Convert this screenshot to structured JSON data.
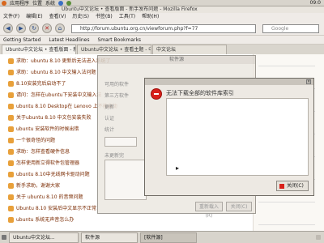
{
  "top_panel": {
    "items": [
      "应用程序",
      "位置",
      "系统"
    ],
    "clock": "09:0"
  },
  "window_title": "Ubuntu中文论坛 • 查看版面 - 新手发布问题 - Mozilla Firefox",
  "menu": [
    "文件(F)",
    "编辑(E)",
    "查看(V)",
    "历史(S)",
    "书签(B)",
    "工具(T)",
    "帮助(H)"
  ],
  "url": "http://forum.ubuntu.org.cn/viewforum.php?f=77",
  "search_placeholder": "Google",
  "bookmarks": [
    "Getting Started",
    "Latest Headlines",
    "Smart Bookmarks"
  ],
  "tabs": [
    {
      "label": "Ubuntu中文论坛 • 查看版面 - 新手...",
      "active": true
    },
    {
      "label": "Ubuntu中文论坛 • 查看主题 - 中...",
      "active": false
    },
    {
      "label": "中文论坛",
      "active": false
    }
  ],
  "page_rows": [
    "求助：ubuntu 8.10 更新后无法进入系统了",
    "求助：ubuntu 8.10 中文输入法问题",
    "8.10安装完后启动不了",
    "请问：怎样在ubuntu下安装中文输入法",
    "ubuntu 8.10 Desktop在 Lenovo 上不能启动",
    "关于ubuntu 8.10 中文包安装失败",
    "ubuntu 安装软件的时候出错",
    "一个很奇怪的问题",
    "求助：怎样查看硬件信息",
    "怎样使用新立得软件包管理器",
    "ubuntu 8.10中无线网卡驱动问题",
    "新手求助，谢谢大家",
    "关于 ubuntu 8.10 的音频问题",
    "Ubuntu 8.10 安装后中文显示不正常",
    "ubuntu 系统无声音怎么办"
  ],
  "back_dialog": {
    "title": "软件源",
    "labels": [
      "可用的软件",
      "第三方软件",
      "更新",
      "认证",
      "统计"
    ],
    "section": "未更新完",
    "buttons": [
      "重新载入(R)",
      "关闭(C)"
    ]
  },
  "error_dialog": {
    "message": "无法下载全部的软件库索引",
    "details": "",
    "close_label": "关闭(C)"
  },
  "taskbar": [
    {
      "label": "Ubuntu中文论坛...",
      "active": false
    },
    {
      "label": "软件源",
      "active": false
    },
    {
      "label": "[软件源]",
      "active": true
    }
  ]
}
